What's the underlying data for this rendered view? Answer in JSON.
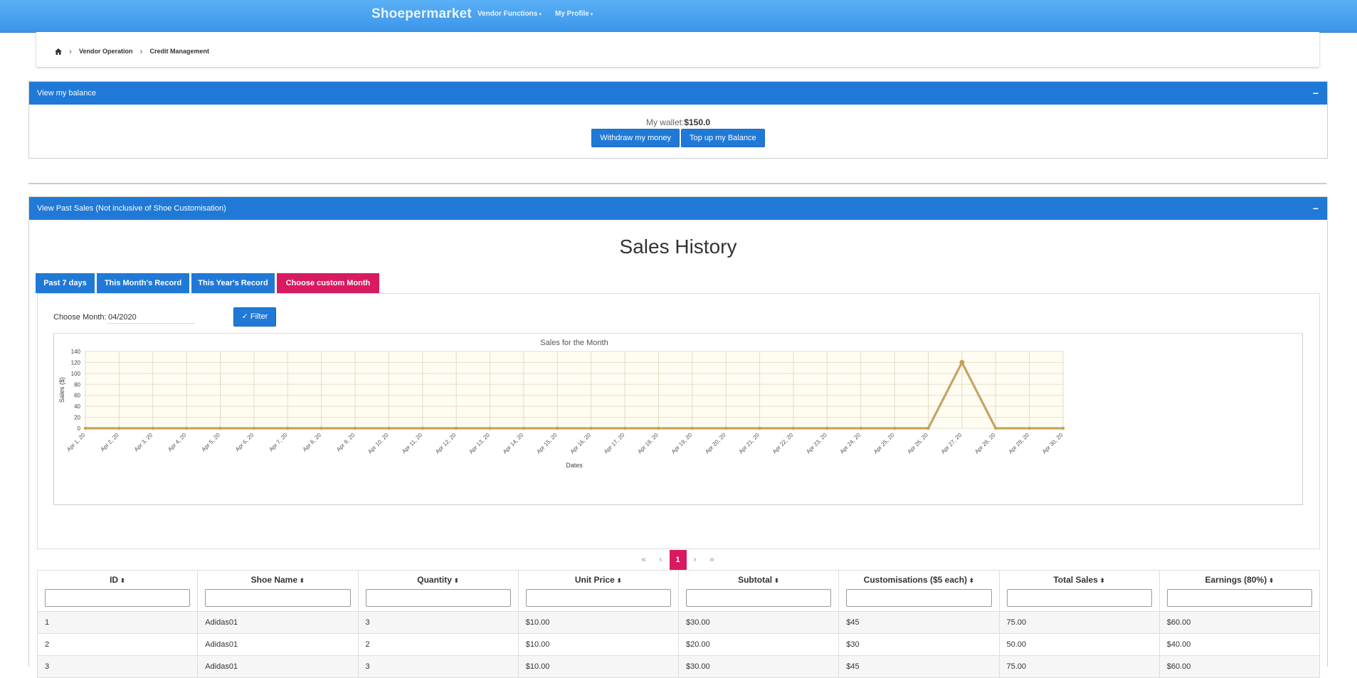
{
  "nav": {
    "brand": "Shoepermarket",
    "vendor_functions": "Vendor Functions",
    "my_profile": "My Profile"
  },
  "breadcrumb": [
    "Vendor Operation",
    "Credit Management"
  ],
  "balance_panel": {
    "title": "View my balance",
    "collapse": "−",
    "wallet_label": "My wallet:",
    "wallet_amount": "$150.0",
    "withdraw_label": "Withdraw my money",
    "topup_label": "Top up my Balance"
  },
  "sales_panel": {
    "title": "View Past Sales (Not inclusive of Shoe Customisation)",
    "collapse": "−",
    "heading": "Sales History",
    "tabs": [
      "Past 7 days",
      "This Month's Record",
      "This Year's Record",
      "Choose custom Month"
    ],
    "active_tab": 3,
    "choose_month_label": "Choose Month:",
    "month_value": "04/2020",
    "filter_label": "Filter"
  },
  "chart_data": {
    "type": "line",
    "title": "Sales for the Month",
    "xlabel": "Dates",
    "ylabel": "Sales ($)",
    "ylim": [
      0,
      140
    ],
    "yticks": [
      0,
      20,
      40,
      60,
      80,
      100,
      120,
      140
    ],
    "categories": [
      "Apr 1, 20",
      "Apr 2, 20",
      "Apr 3, 20",
      "Apr 4, 20",
      "Apr 5, 20",
      "Apr 6, 20",
      "Apr 7, 20",
      "Apr 8, 20",
      "Apr 9, 20",
      "Apr 10, 20",
      "Apr 11, 20",
      "Apr 12, 20",
      "Apr 13, 20",
      "Apr 14, 20",
      "Apr 15, 20",
      "Apr 16, 20",
      "Apr 17, 20",
      "Apr 18, 20",
      "Apr 19, 20",
      "Apr 20, 20",
      "Apr 21, 20",
      "Apr 22, 20",
      "Apr 23, 20",
      "Apr 24, 20",
      "Apr 25, 20",
      "Apr 26, 20",
      "Apr 27, 20",
      "Apr 28, 20",
      "Apr 29, 20",
      "Apr 30, 20"
    ],
    "series": [
      {
        "values": [
          0,
          0,
          0,
          0,
          0,
          0,
          0,
          0,
          0,
          0,
          0,
          0,
          0,
          0,
          0,
          0,
          0,
          0,
          0,
          0,
          0,
          0,
          0,
          0,
          0,
          0,
          120,
          0,
          0,
          0
        ],
        "color": "#c8a050"
      }
    ],
    "grid": true,
    "plot_background": "#fffdf2"
  },
  "pager": {
    "first": "«",
    "prev": "‹",
    "current": "1",
    "next": "›",
    "last": "»"
  },
  "table": {
    "columns": [
      "ID",
      "Shoe Name",
      "Quantity",
      "Unit Price",
      "Subtotal",
      "Customisations ($5 each)",
      "Total Sales",
      "Earnings (80%)"
    ],
    "rows": [
      [
        "1",
        "Adidas01",
        "3",
        "$10.00",
        "$30.00",
        "$45",
        "75.00",
        "$60.00"
      ],
      [
        "2",
        "Adidas01",
        "2",
        "$10.00",
        "$20.00",
        "$30",
        "50.00",
        "$40.00"
      ],
      [
        "3",
        "Adidas01",
        "3",
        "$10.00",
        "$30.00",
        "$45",
        "75.00",
        "$60.00"
      ]
    ]
  },
  "colors": {
    "primary": "#2079d6",
    "accent": "#d81b60",
    "navbar": "#4aa3f0"
  }
}
